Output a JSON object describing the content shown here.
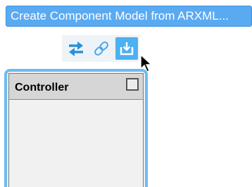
{
  "tooltip": {
    "text": "Create Component Model from ARXML..."
  },
  "toolbar": {
    "items": [
      {
        "icon": "swap-arrows-icon",
        "active": false
      },
      {
        "icon": "link-icon",
        "active": false
      },
      {
        "icon": "import-download-icon",
        "active": true
      }
    ]
  },
  "component": {
    "title": "Controller"
  },
  "colors": {
    "accent": "#5aaaf2",
    "active_button": "#4db0f0",
    "component_border": "#6cbcf2",
    "header_bg": "#d6d6d6"
  }
}
